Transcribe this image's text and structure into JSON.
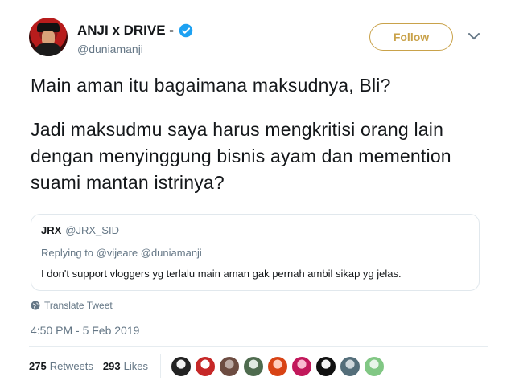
{
  "author": {
    "display_name": "ANJI x DRIVE -",
    "handle": "@duniamanji",
    "verified": true,
    "follow_label": "Follow"
  },
  "tweet": {
    "paragraphs": [
      "Main aman itu bagaimana maksudnya, Bli?",
      "Jadi maksudmu saya harus mengkritisi orang lain dengan menyinggung bisnis ayam dan memention suami mantan istrinya?"
    ]
  },
  "quoted": {
    "name": "JRX",
    "handle": "@JRX_SID",
    "replying_to": "Replying to @vijeare @duniamanji",
    "text": "I don't support vloggers yg terlalu main aman gak pernah ambil sikap yg jelas."
  },
  "translate_label": "Translate Tweet",
  "timestamp": "4:50 PM - 5 Feb 2019",
  "stats": {
    "retweets_count": "275",
    "retweets_label": "Retweets",
    "likes_count": "293",
    "likes_label": "Likes"
  },
  "liker_avatars": [
    {
      "name": "liker-avatar-1",
      "colors": [
        "#222222",
        "#f1f1f1"
      ]
    },
    {
      "name": "liker-avatar-2",
      "colors": [
        "#c62828",
        "#ffffff"
      ]
    },
    {
      "name": "liker-avatar-3",
      "colors": [
        "#6d4c41",
        "#bcaaa4"
      ]
    },
    {
      "name": "liker-avatar-4",
      "colors": [
        "#4e6b4e",
        "#dfe9e0"
      ]
    },
    {
      "name": "liker-avatar-5",
      "colors": [
        "#d84315",
        "#ffccbc"
      ]
    },
    {
      "name": "liker-avatar-6",
      "colors": [
        "#c2185b",
        "#f8bbd0"
      ]
    },
    {
      "name": "liker-avatar-7",
      "colors": [
        "#111111",
        "#f5f5f5"
      ]
    },
    {
      "name": "liker-avatar-8",
      "colors": [
        "#546e7a",
        "#cfd8dc"
      ]
    },
    {
      "name": "liker-avatar-9",
      "colors": [
        "#81c784",
        "#e8f5e9"
      ]
    }
  ],
  "colors": {
    "follow_accent": "#c9a24a",
    "verified_blue": "#1da1f2",
    "secondary_text": "#657786"
  }
}
